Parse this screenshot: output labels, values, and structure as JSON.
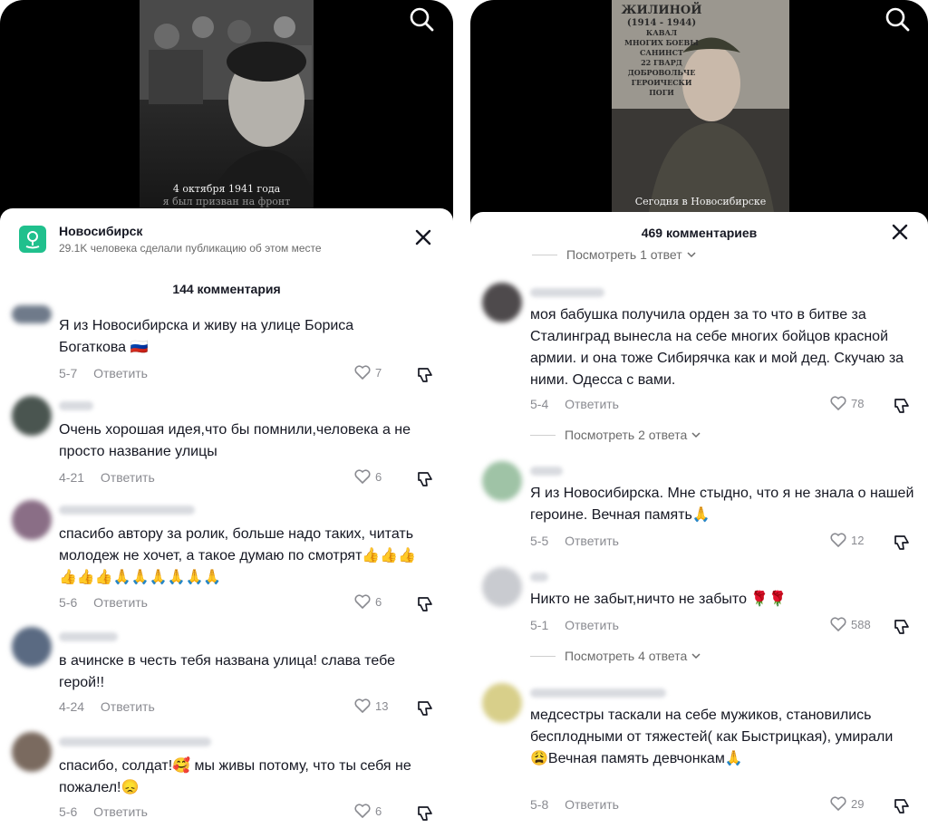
{
  "left": {
    "place": {
      "name": "Новосибирск",
      "subtitle": "29.1K человека сделали публикацию об этом месте"
    },
    "video_caption": "4 октября 1941 года",
    "video_caption_2": "я был призван на фронт",
    "count": "144 комментария",
    "comments": [
      {
        "text": "Я из Новосибирска и живу на улице Бориса Богаткова 🇷🇺",
        "date": "5-7",
        "reply": "Ответить",
        "likes": "7"
      },
      {
        "text": "Очень хорошая идея,что бы помнили,человека а не просто название улицы",
        "date": "4-21",
        "reply": "Ответить",
        "likes": "6"
      },
      {
        "text": "спасибо автору за ролик, больше надо таких, читать молодеж не хочет, а такое думаю по смотрят👍👍👍👍👍👍🙏🙏🙏🙏🙏🙏",
        "date": "5-6",
        "reply": "Ответить",
        "likes": "6"
      },
      {
        "text": "в ачинске в честь тебя названа улица! слава тебе герой!!",
        "date": "4-24",
        "reply": "Ответить",
        "likes": "13"
      },
      {
        "text": "спасибо, солдат!🥰 мы живы потому, что ты себя не пожалел!😞",
        "date": "5-6",
        "reply": "Ответить",
        "likes": "6"
      }
    ]
  },
  "right": {
    "video_caption": "Сегодня в Новосибирске",
    "plaque": [
      "ЖИЛИНОЙ",
      "(1914 - 1944)",
      "КАВАЛ",
      "МНОГИХ БОЕВЫ",
      "САНИНСТ",
      "22 ГВАРД",
      "ДОБРОВОЛЬЧЕ",
      "ГЕРОИЧЕСКИ ПОГИ"
    ],
    "count": "469 комментариев",
    "top_replies": "Посмотреть 1 ответ",
    "comments": [
      {
        "text": "моя бабушка получила орден за то что в битве за Сталинград вынесла на себе многих бойцов красной армии. и она тоже Сибирячка как и мой дед. Скучаю за ними. Одесса с вами.",
        "date": "5-4",
        "reply": "Ответить",
        "likes": "78",
        "replies": "Посмотреть 2 ответа"
      },
      {
        "text": "Я из Новосибирска. Мне стыдно, что я не знала о нашей героине. Вечная память🙏",
        "date": "5-5",
        "reply": "Ответить",
        "likes": "12"
      },
      {
        "text": "Никто не забыт,ничто не забыто 🌹🌹",
        "date": "5-1",
        "reply": "Ответить",
        "likes": "588",
        "replies": "Посмотреть 4 ответа"
      },
      {
        "text": "медсестры таскали на себе мужиков, становились бесплодными от тяжестей( как Быстрицкая), умирали😩Вечная память девчонкам🙏",
        "date": "5-8",
        "reply": "Ответить",
        "likes": "29"
      }
    ]
  },
  "colors": {
    "accent_place": "#20c08d",
    "text_primary": "#161823",
    "text_secondary": "#8a8b91"
  },
  "icons": [
    "search-icon",
    "close-icon",
    "heart-icon",
    "dislike-icon",
    "location-pin-icon",
    "chevron-down-icon"
  ]
}
